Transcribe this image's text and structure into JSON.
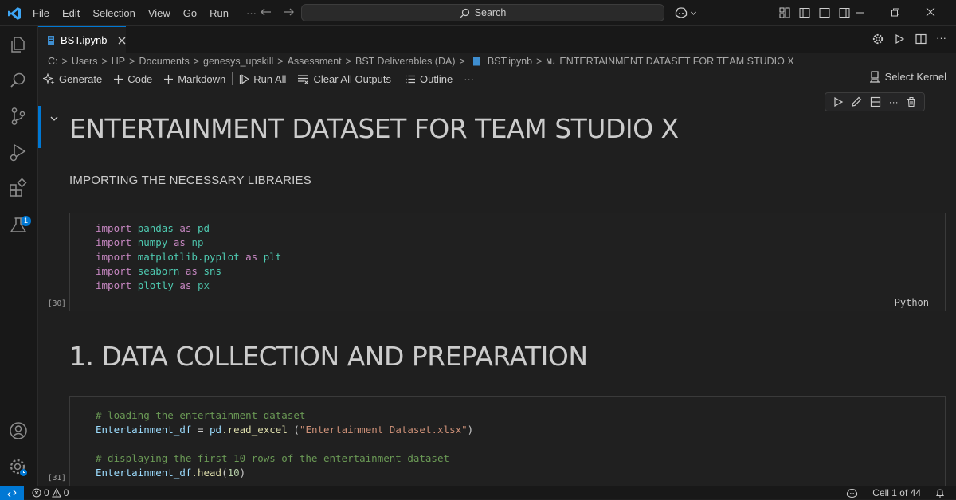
{
  "menu": [
    "File",
    "Edit",
    "Selection",
    "View",
    "Go",
    "Run",
    "···"
  ],
  "search": {
    "label": "Search"
  },
  "tab": {
    "label": "BST.ipynb"
  },
  "breadcrumb": [
    "C:",
    "Users",
    "HP",
    "Documents",
    "genesys_upskill",
    "Assessment",
    "BST Deliverables (DA)",
    "BST.ipynb",
    "ENTERTAINMENT DATASET FOR TEAM STUDIO X"
  ],
  "breadcrumb_md_prefix": "M↓",
  "toolbar": {
    "generate": "Generate",
    "code": "Code",
    "markdown": "Markdown",
    "run_all": "Run All",
    "clear_outputs": "Clear All Outputs",
    "outline": "Outline",
    "more": "···",
    "select_kernel": "Select Kernel"
  },
  "activity": {
    "extensions_badge": "1"
  },
  "cells": {
    "title": "ENTERTAINMENT DATASET FOR TEAM STUDIO X",
    "importing_text": "IMPORTING THE NECESSARY LIBRARIES",
    "import_cell": {
      "exec_count": "[30]",
      "language": "Python",
      "lines": [
        {
          "kw": "import",
          "mod": "pandas",
          "as": "as",
          "alias": "pd"
        },
        {
          "kw": "import",
          "mod": "numpy",
          "as": "as",
          "alias": "np"
        },
        {
          "kw": "import",
          "mod": "matplotlib.pyplot",
          "as": "as",
          "alias": "plt"
        },
        {
          "kw": "import",
          "mod": "seaborn",
          "as": "as",
          "alias": "sns"
        },
        {
          "kw": "import",
          "mod": "plotly",
          "as": "as",
          "alias": "px"
        }
      ]
    },
    "section_heading": "1. DATA COLLECTION AND PREPARATION",
    "load_cell": {
      "exec_count": "[31]",
      "comment1": "# loading the entertainment dataset",
      "var": "Entertainment_df",
      "eq": " = ",
      "obj": "pd",
      "method": ".read_excel",
      "open": " (",
      "string": "\"Entertainment Dataset.xlsx\"",
      "close": ")",
      "comment2": "# displaying the first 10 rows of the entertainment dataset",
      "var2": "Entertainment_df",
      "method2": ".head",
      "arg_open": "(",
      "arg": "10",
      "arg_close": ")"
    }
  },
  "status": {
    "errors": "0",
    "warnings": "0",
    "cell_position": "Cell 1 of 44"
  },
  "colors": {
    "accent": "#0078d4",
    "background": "#1f1f1f",
    "keyword": "#c586c0",
    "module": "#4ec9b0",
    "comment": "#6a9955",
    "string": "#ce9178"
  }
}
